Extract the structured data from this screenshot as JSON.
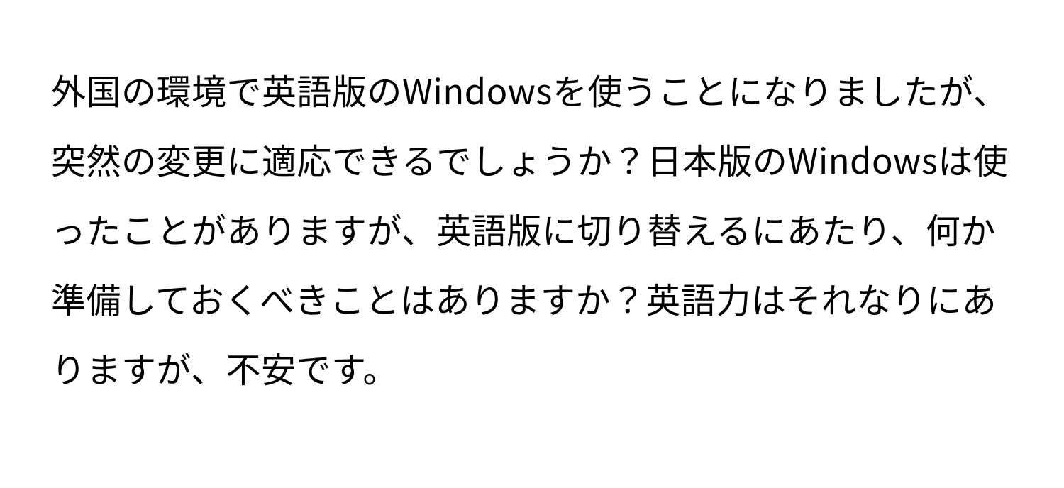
{
  "document": {
    "paragraph": "外国の環境で英語版のWindowsを使うことになりましたが、突然の変更に適応できるでしょうか？日本版のWindowsは使ったことがありますが、英語版に切り替えるにあたり、何か準備しておくべきことはありますか？英語力はそれなりにありますが、不安です。"
  }
}
